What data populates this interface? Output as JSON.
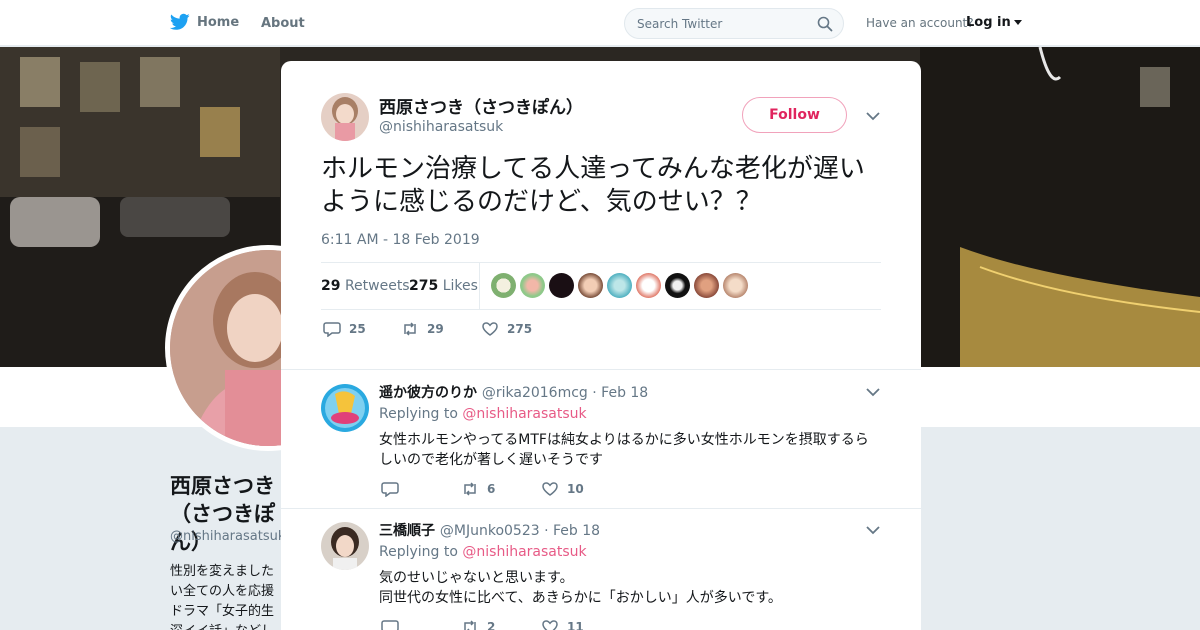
{
  "nav": {
    "home_label": "Home",
    "about_label": "About",
    "search_placeholder": "Search Twitter",
    "account_text": "Have an account?",
    "login_label": "Log in"
  },
  "background_profile": {
    "name": "西原さつき（さつきぽん）",
    "handle": "@nishiharasatsuk",
    "bio_lines": [
      "性別を変えました",
      "い全ての人を応援",
      "ドラマ「女子的生",
      "深イイ話」などし"
    ]
  },
  "tweet": {
    "author_name": "西原さつき（さつきぽん）",
    "author_handle": "@nishiharasatsuk",
    "follow_label": "Follow",
    "text": "ホルモン治療してる人達ってみんな老化が遅いように感じるのだけど、気のせい？？",
    "timestamp": "6:11 AM - 18 Feb 2019",
    "retweets_count": "29",
    "retweets_label": "Retweets",
    "likes_count": "275",
    "likes_label": "Likes",
    "action_reply_count": "25",
    "action_retweet_count": "29",
    "action_like_count": "275"
  },
  "replies": [
    {
      "name": "遥か彼方のりか",
      "meta": "@rika2016mcg · Feb 18",
      "replying_prefix": "Replying to",
      "replying_to": "@nishiharasatsuk",
      "text": "女性ホルモンやってるMTFは純女よりはるかに多い女性ホルモンを摂取するらしいので老化が著しく遅いそうです",
      "retweets": "6",
      "likes": "10"
    },
    {
      "name": "三橋順子",
      "meta": "@MJunko0523 · Feb 18",
      "replying_prefix": "Replying to",
      "replying_to": "@nishiharasatsuk",
      "text_line1": "気のせいじゃないと思います。",
      "text_line2": "同世代の女性に比べて、あきらかに「おかしい」人が多いです。",
      "retweets": "2",
      "likes": "11"
    }
  ],
  "colors": {
    "twitter_blue": "#1da1f2",
    "follow_pink": "#e0245e",
    "muted_text": "#657786"
  }
}
